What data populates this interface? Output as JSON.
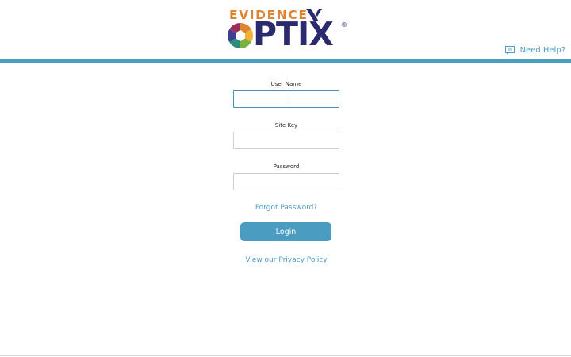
{
  "brand": {
    "logo_top": "EVIDENCE",
    "logo_bottom": "PTIX",
    "registered_mark": "®",
    "colors": {
      "orange": "#e0822f",
      "navy": "#2b2a6e",
      "accent": "#4a9cc1"
    }
  },
  "header": {
    "help_label": "Need Help?",
    "help_icon": "chat-icon"
  },
  "form": {
    "username": {
      "label": "User Name",
      "value": "",
      "placeholder": ""
    },
    "sitekey": {
      "label": "Site Key",
      "value": "",
      "placeholder": ""
    },
    "password": {
      "label": "Password",
      "value": "",
      "placeholder": ""
    },
    "forgot_label": "Forgot Password?",
    "login_label": "Login",
    "privacy_label": "View our Privacy Policy"
  }
}
